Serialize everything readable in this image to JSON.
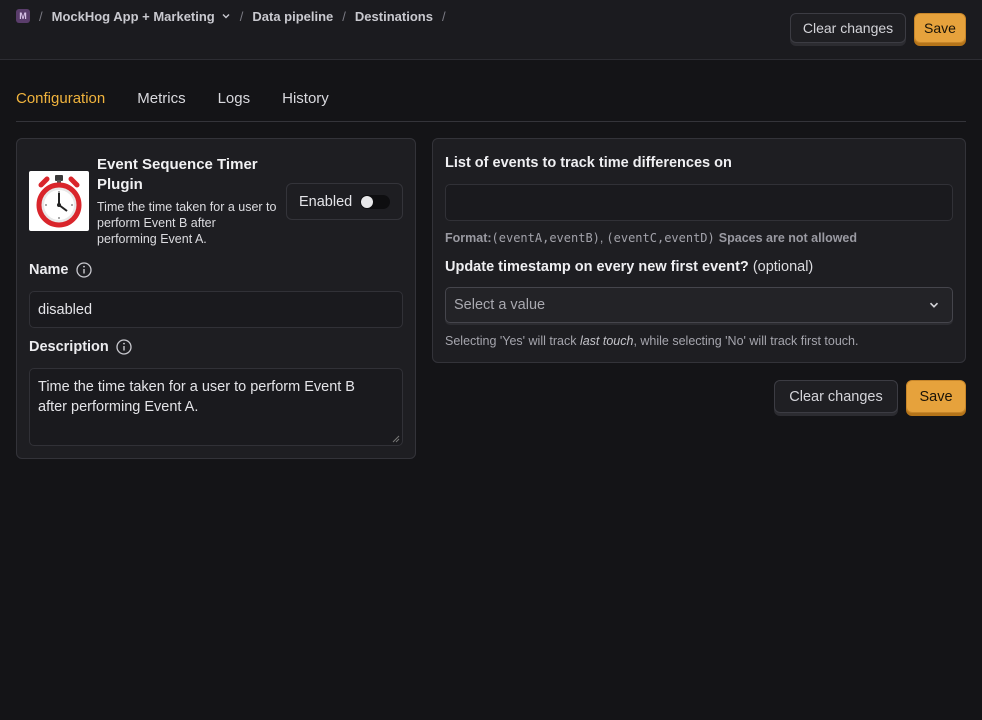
{
  "breadcrumb": {
    "project_badge": "M",
    "project": "MockHog App + Marketing",
    "section": "Data pipeline",
    "page": "Destinations",
    "separator": "/"
  },
  "header_actions": {
    "clear_label": "Clear changes",
    "save_label": "Save"
  },
  "tabs": [
    {
      "label": "Configuration",
      "active": true
    },
    {
      "label": "Metrics",
      "active": false
    },
    {
      "label": "Logs",
      "active": false
    },
    {
      "label": "History",
      "active": false
    }
  ],
  "plugin": {
    "name": "Event Sequence Timer Plugin",
    "description": "Time the time taken for a user to perform Event B after performing Event A.",
    "enabled_label": "Enabled",
    "enabled": false,
    "logo_icon": "stopwatch-icon"
  },
  "form": {
    "name_label": "Name",
    "name_value": "disabled",
    "description_label": "Description",
    "description_value": "Time the time taken for a user to perform Event B after performing Event A."
  },
  "config": {
    "events_label": "List of events to track time differences on",
    "events_value": "",
    "format_label": "Format:",
    "format_example_1": "(eventA,eventB)",
    "format_comma": ",",
    "format_example_2": "(eventC,eventD)",
    "format_note": "Spaces are not allowed",
    "timestamp_label": "Update timestamp on every new first event?",
    "timestamp_optional": "(optional)",
    "timestamp_placeholder": "Select a value",
    "help_prefix": "Selecting 'Yes' will track ",
    "help_emphasis": "last touch",
    "help_suffix": ", while selecting 'No' will track first touch."
  },
  "footer_actions": {
    "clear_label": "Clear changes",
    "save_label": "Save"
  },
  "colors": {
    "accent": "#e6a23c",
    "active_tab": "#f0b33d",
    "background": "#141417",
    "panel": "#1e1e22"
  }
}
